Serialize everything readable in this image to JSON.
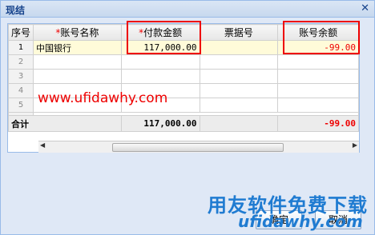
{
  "window": {
    "title": "现结",
    "close_glyph": "✕"
  },
  "grid": {
    "columns": [
      "序号",
      "账号名称",
      "付款金额",
      "票据号",
      "账号余额"
    ],
    "required_mark": "*",
    "rows": [
      {
        "n": "1",
        "account": "中国银行",
        "amount": "117,000.00",
        "note": "",
        "balance": "-99.00"
      },
      {
        "n": "2",
        "account": "",
        "amount": "",
        "note": "",
        "balance": ""
      },
      {
        "n": "3",
        "account": "",
        "amount": "",
        "note": "",
        "balance": ""
      },
      {
        "n": "4",
        "account": "",
        "amount": "",
        "note": "",
        "balance": ""
      },
      {
        "n": "5",
        "account": "",
        "amount": "",
        "note": "",
        "balance": ""
      }
    ],
    "total": {
      "label": "合计",
      "amount": "117,000.00",
      "balance": "-99.00"
    }
  },
  "watermark": {
    "url": "www.ufidawhy.com",
    "logo_cn": "用友软件免费下载",
    "logo_url": "ufidawhy.com"
  },
  "buttons": {
    "ok": "确定",
    "cancel": "取消"
  }
}
